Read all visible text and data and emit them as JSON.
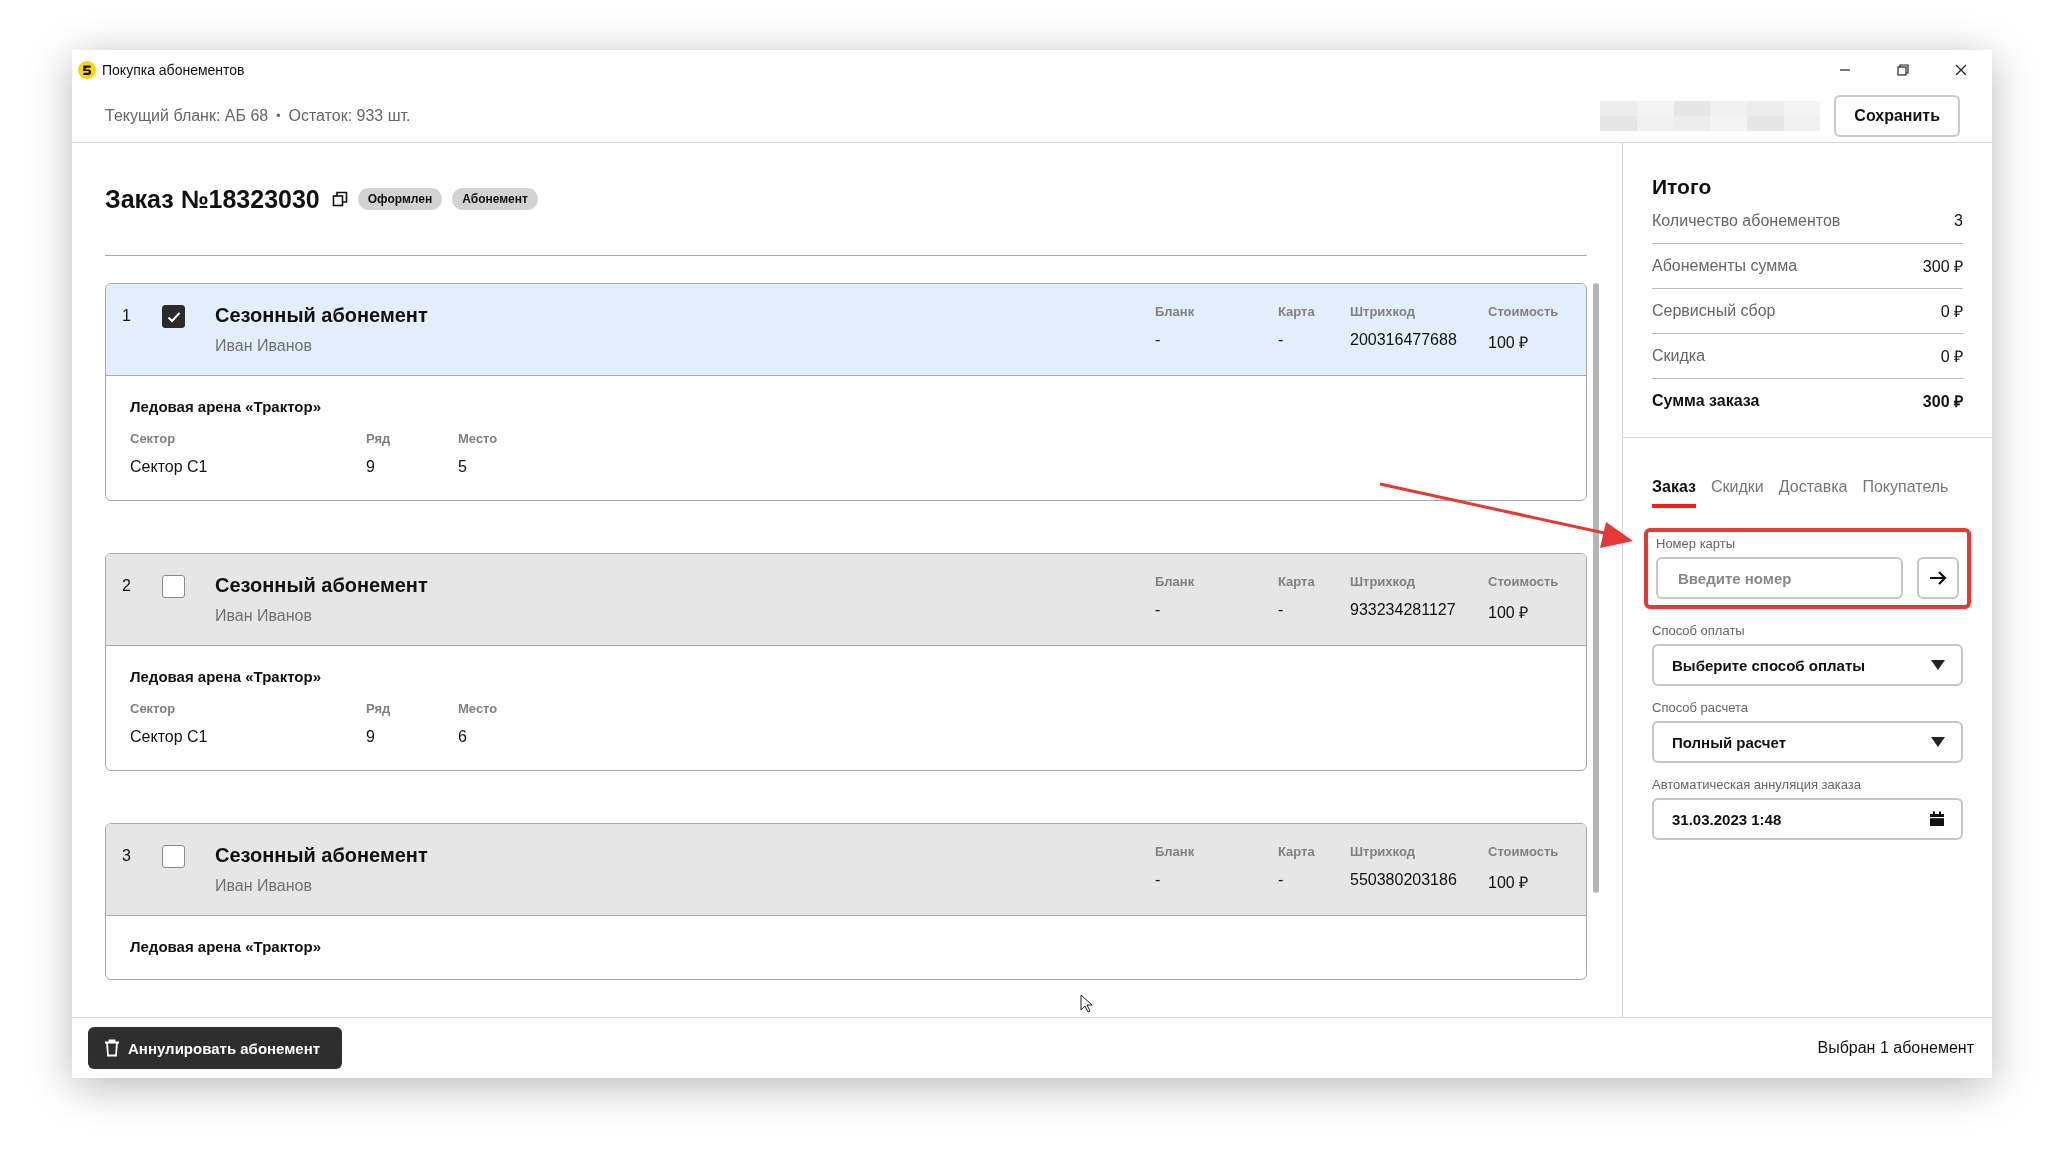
{
  "window": {
    "title": "Покупка абонементов"
  },
  "header": {
    "blank": "Текущий бланк: АБ 68",
    "separator": "•",
    "remaining": "Остаток: 933 шт.",
    "save_button": "Сохранить"
  },
  "order": {
    "title": "Заказ №18323030",
    "tags": [
      "Оформлен",
      "Абонемент"
    ]
  },
  "tickets": [
    {
      "number": "1",
      "checked": true,
      "name": "Сезонный абонемент",
      "holder": "Иван Иванов",
      "fields": [
        {
          "label": "Бланк",
          "value": "-"
        },
        {
          "label": "Карта",
          "value": "-"
        },
        {
          "label": "Штрихкод",
          "value": "200316477688"
        },
        {
          "label": "Стоимость",
          "value": "100 ₽"
        }
      ],
      "venue": "Ледовая арена «Трактор»",
      "seat": [
        {
          "label": "Сектор",
          "value": "Сектор С1"
        },
        {
          "label": "Ряд",
          "value": "9"
        },
        {
          "label": "Место",
          "value": "5"
        }
      ]
    },
    {
      "number": "2",
      "checked": false,
      "name": "Сезонный абонемент",
      "holder": "Иван Иванов",
      "fields": [
        {
          "label": "Бланк",
          "value": "-"
        },
        {
          "label": "Карта",
          "value": "-"
        },
        {
          "label": "Штрихкод",
          "value": "933234281127"
        },
        {
          "label": "Стоимость",
          "value": "100 ₽"
        }
      ],
      "venue": "Ледовая арена «Трактор»",
      "seat": [
        {
          "label": "Сектор",
          "value": "Сектор С1"
        },
        {
          "label": "Ряд",
          "value": "9"
        },
        {
          "label": "Место",
          "value": "6"
        }
      ]
    },
    {
      "number": "3",
      "checked": false,
      "name": "Сезонный абонемент",
      "holder": "Иван Иванов",
      "fields": [
        {
          "label": "Бланк",
          "value": "-"
        },
        {
          "label": "Карта",
          "value": "-"
        },
        {
          "label": "Штрихкод",
          "value": "550380203186"
        },
        {
          "label": "Стоимость",
          "value": "100 ₽"
        }
      ],
      "venue": "Ледовая арена «Трактор»"
    }
  ],
  "summary": {
    "title": "Итого",
    "rows": [
      {
        "kind": "line",
        "label": "Количество абонементов",
        "value": "3"
      },
      {
        "kind": "line",
        "label": "Абонементы сумма",
        "value": "300 ₽"
      },
      {
        "kind": "line",
        "label": "Сервисный сбор",
        "value": "0 ₽"
      },
      {
        "kind": "line",
        "label": "Скидка",
        "value": "0 ₽"
      },
      {
        "kind": "total",
        "label": "Сумма заказа",
        "value": "300 ₽"
      }
    ]
  },
  "tabs": [
    {
      "label": "Заказ",
      "selected": true
    },
    {
      "label": "Скидки",
      "selected": false
    },
    {
      "label": "Доставка",
      "selected": false
    },
    {
      "label": "Покупатель",
      "selected": false
    }
  ],
  "card_number": {
    "label": "Номер карты",
    "placeholder": "Введите номер"
  },
  "payment": {
    "label": "Способ оплаты",
    "value": "Выберите способ оплаты"
  },
  "settlement": {
    "label": "Способ расчета",
    "value": "Полный расчет"
  },
  "auto_cancel": {
    "label": "Автоматическая аннуляция заказа",
    "value": "31.03.2023 1:48"
  },
  "footer": {
    "cancel_button": "Аннулировать абонемент",
    "status": "Выбран 1 абонемент"
  }
}
